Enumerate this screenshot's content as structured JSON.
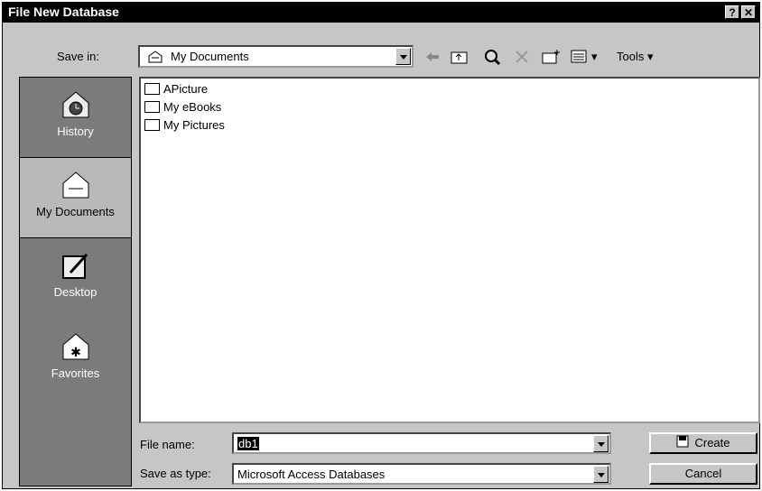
{
  "window": {
    "title": "File New Database",
    "help_button": "?",
    "close_button": "✕"
  },
  "save_in": {
    "label": "Save in:",
    "value": "My Documents"
  },
  "toolbar": {
    "tools_label": "Tools ▾",
    "views_label": "▾"
  },
  "places": [
    {
      "label": "History"
    },
    {
      "label": "My Documents"
    },
    {
      "label": "Desktop"
    },
    {
      "label": "Favorites"
    }
  ],
  "files": [
    {
      "name": "APicture"
    },
    {
      "name": "My eBooks"
    },
    {
      "name": "My Pictures"
    }
  ],
  "file_name": {
    "label": "File name:",
    "value": "db1"
  },
  "save_type": {
    "label": "Save as type:",
    "value": "Microsoft Access Databases"
  },
  "buttons": {
    "create": "Create",
    "cancel": "Cancel"
  }
}
